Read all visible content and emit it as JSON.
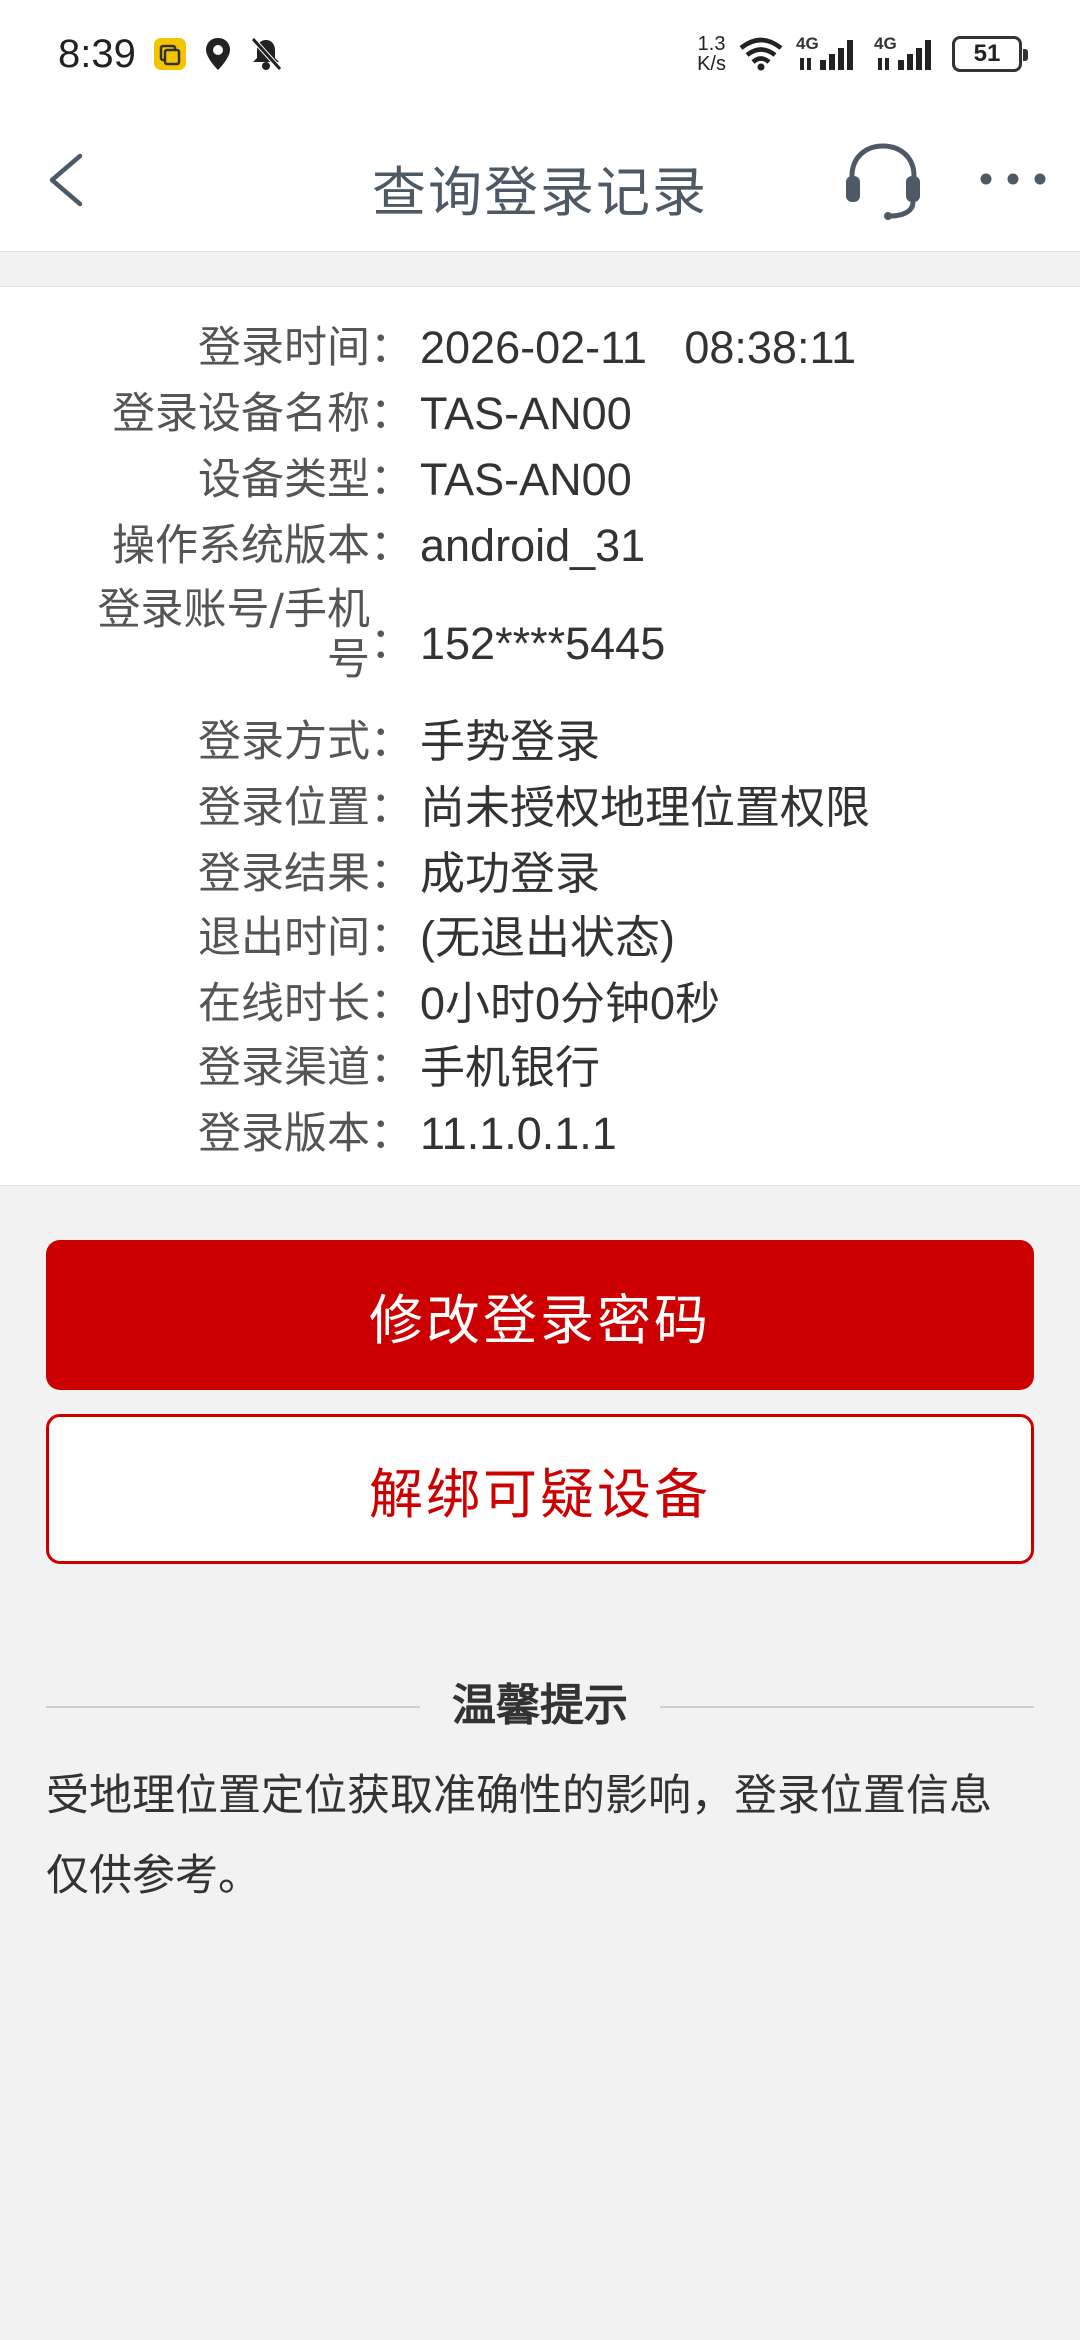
{
  "status_bar": {
    "time": "8:39",
    "net_speed_value": "1.3",
    "net_speed_unit": "K/s",
    "signal1_label": "4G",
    "signal2_label": "4G",
    "battery": "51"
  },
  "nav": {
    "title": "查询登录记录"
  },
  "info": {
    "colon": "：",
    "rows": [
      {
        "label": "登录时间",
        "value": "2026-02-11   08:38:11"
      },
      {
        "label": "登录设备名称",
        "value": "TAS-AN00"
      },
      {
        "label": "设备类型",
        "value": "TAS-AN00"
      },
      {
        "label": "操作系统版本",
        "value": "android_31"
      },
      {
        "label_line1": "登录账号/手机",
        "label_line2": "号",
        "value": "152****5445"
      },
      {
        "label": "登录方式",
        "value": "手势登录"
      },
      {
        "label": "登录位置",
        "value": "尚未授权地理位置权限"
      },
      {
        "label": "登录结果",
        "value": "成功登录"
      },
      {
        "label": "退出时间",
        "value": "(无退出状态)"
      },
      {
        "label": "在线时长",
        "value": "0小时0分钟0秒"
      },
      {
        "label": "登录渠道",
        "value": "手机银行"
      },
      {
        "label": "登录版本",
        "value": "11.1.0.1.1"
      }
    ]
  },
  "buttons": {
    "change_password": "修改登录密码",
    "unbind_device": "解绑可疑设备"
  },
  "tips": {
    "title": "温馨提示",
    "text": "受地理位置定位获取准确性的影响，登录位置信息仅供参考。"
  },
  "colors": {
    "accent": "#cc0000",
    "title": "#4d5a66",
    "background": "#f2f2f2"
  }
}
